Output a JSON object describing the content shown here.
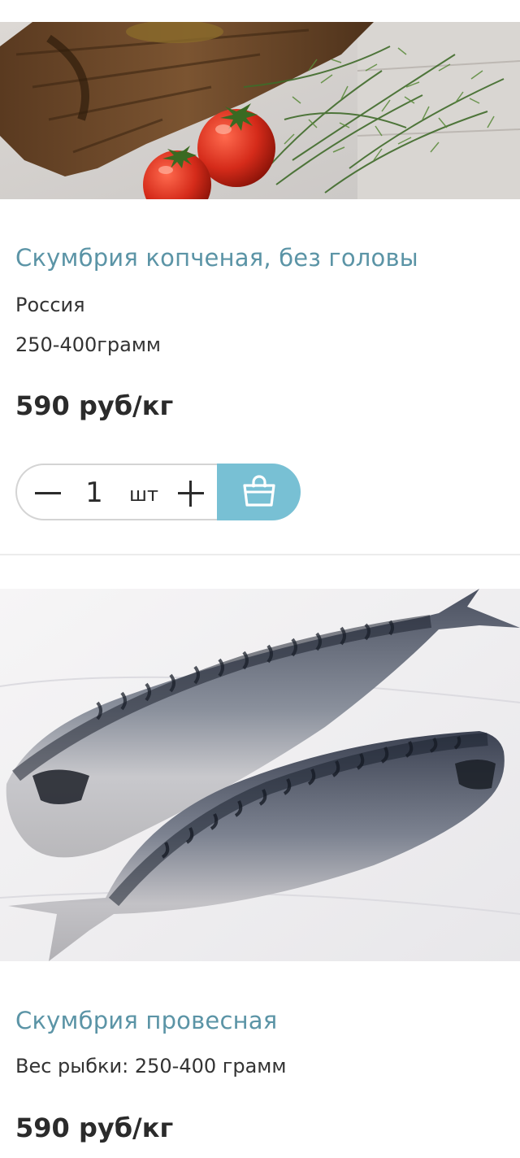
{
  "products": [
    {
      "title": "Скумбрия копченая, без головы",
      "origin": "Россия",
      "weight": "250-400грамм",
      "price": "590 руб/кг",
      "image": "smoked-mackerel-board-tomato-dill",
      "quantity": {
        "value": "1",
        "unit": "шт"
      }
    },
    {
      "title": "Скумбрия провесная",
      "weight": "Вес рыбки: 250-400 грамм",
      "price": "590 руб/кг",
      "image": "two-cured-mackerel-fish"
    }
  ],
  "colors": {
    "title": "#5b94a6",
    "accent": "#78c0d4",
    "text": "#333333",
    "divider": "#ececec"
  },
  "icons": {
    "decrease": "minus-icon",
    "increase": "plus-icon",
    "cart": "shopping-basket-icon"
  }
}
